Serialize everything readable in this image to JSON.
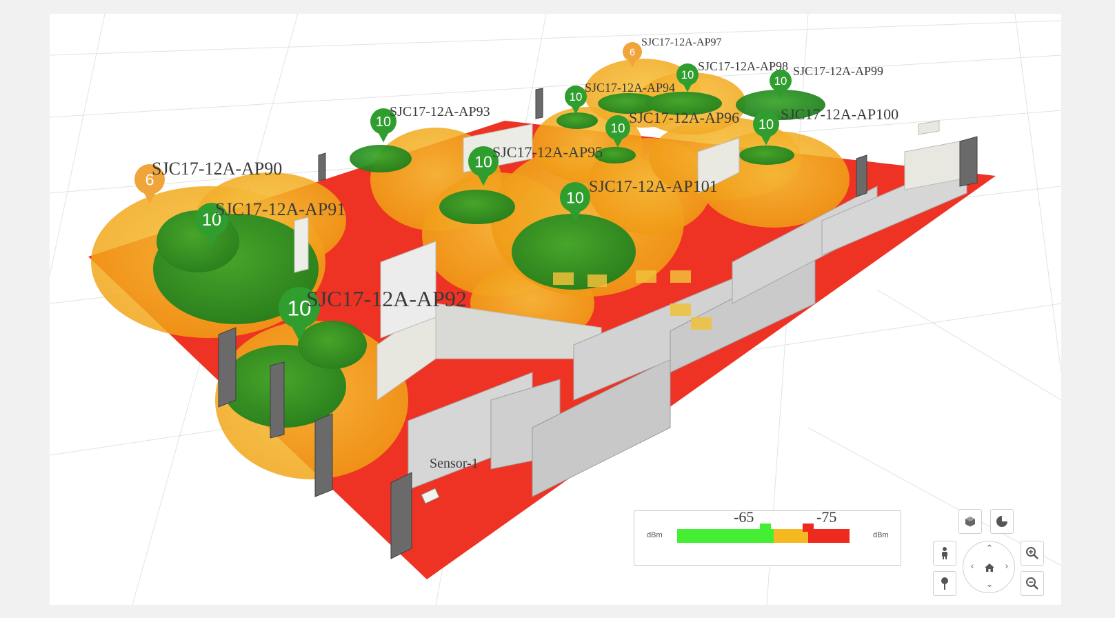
{
  "access_points": [
    {
      "name": "SJC17-12A-AP90",
      "count": "6",
      "color": "#f0a53a"
    },
    {
      "name": "SJC17-12A-AP91",
      "count": "10",
      "color": "#2f9e2f"
    },
    {
      "name": "SJC17-12A-AP92",
      "count": "10",
      "color": "#2f9e2f"
    },
    {
      "name": "SJC17-12A-AP93",
      "count": "10",
      "color": "#2f9e2f"
    },
    {
      "name": "SJC17-12A-AP95",
      "count": "10",
      "color": "#2f9e2f"
    },
    {
      "name": "SJC17-12A-AP94",
      "count": "10",
      "color": "#2f9e2f"
    },
    {
      "name": "SJC17-12A-AP96",
      "count": "10",
      "color": "#2f9e2f"
    },
    {
      "name": "SJC17-12A-AP97",
      "count": "6",
      "color": "#f0a53a"
    },
    {
      "name": "SJC17-12A-AP98",
      "count": "10",
      "color": "#2f9e2f"
    },
    {
      "name": "SJC17-12A-AP99",
      "count": "10",
      "color": "#2f9e2f"
    },
    {
      "name": "SJC17-12A-AP100",
      "count": "10",
      "color": "#2f9e2f"
    },
    {
      "name": "SJC17-12A-AP101",
      "count": "10",
      "color": "#2f9e2f"
    }
  ],
  "sensor": {
    "label": "Sensor-1"
  },
  "legend": {
    "unit_left": "dBm",
    "unit_right": "dBm",
    "threshold_high": "-65",
    "threshold_low": "-75",
    "colors": {
      "strong": "#44ee33",
      "medium": "#f5b820",
      "weak": "#ee2a1e"
    }
  },
  "floor_color": "#ee3324",
  "controls": {
    "view_3d": "cube-icon",
    "coverage_chart": "pie-chart-icon",
    "person": "person-icon",
    "pin": "pin-icon",
    "zoom_in": "zoom-in-icon",
    "zoom_out": "zoom-out-icon",
    "home": "home-icon"
  }
}
